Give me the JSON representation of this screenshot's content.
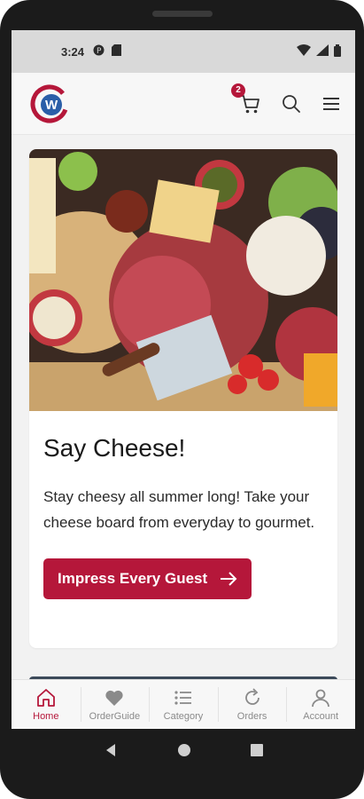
{
  "status_bar": {
    "time": "3:24",
    "icons": [
      "app-notification-icon",
      "sd-card-icon",
      "wifi-icon",
      "signal-icon",
      "battery-icon"
    ]
  },
  "header": {
    "logo_letter": "W",
    "cart_count": "2",
    "icons": [
      "cart-icon",
      "search-icon",
      "menu-icon"
    ]
  },
  "promo": {
    "title": "Say Cheese!",
    "body": "Stay cheesy all summer long! Take your cheese board from everyday to gourmet.",
    "button_label": "Impress Every Guest",
    "button_icon": "arrow-right-icon"
  },
  "bottom_nav": {
    "items": [
      {
        "label": "Home",
        "icon": "home-icon",
        "active": true
      },
      {
        "label": "OrderGuide",
        "icon": "heart-icon",
        "active": false
      },
      {
        "label": "Category",
        "icon": "list-icon",
        "active": false
      },
      {
        "label": "Orders",
        "icon": "refresh-icon",
        "active": false
      },
      {
        "label": "Account",
        "icon": "person-icon",
        "active": false
      }
    ]
  },
  "colors": {
    "brand": "#b5173a",
    "status_bar": "#d9d9d9",
    "inactive": "#8a8a8a"
  }
}
